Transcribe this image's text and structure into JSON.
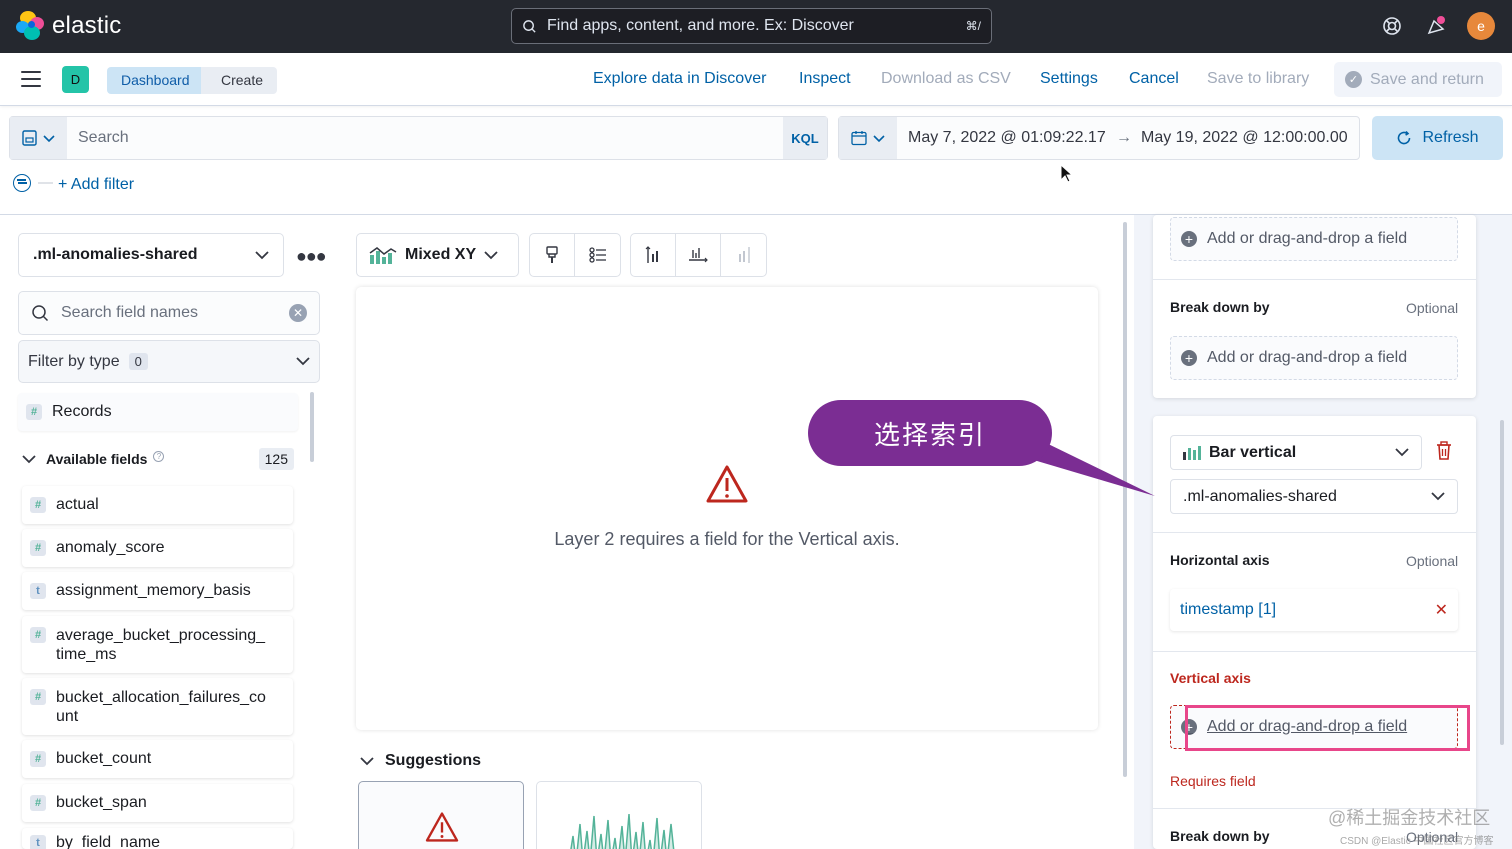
{
  "header": {
    "brand": "elastic",
    "search_placeholder": "Find apps, content, and more. Ex: Discover",
    "search_shortcut": "⌘/",
    "avatar_initial": "e"
  },
  "nav": {
    "space_initial": "D",
    "breadcrumbs": [
      "Dashboard",
      "Create"
    ],
    "links": {
      "explore": "Explore data in Discover",
      "inspect": "Inspect",
      "download_csv": "Download as CSV",
      "settings": "Settings",
      "cancel": "Cancel",
      "save_library": "Save to library",
      "save_return": "Save and return"
    }
  },
  "query": {
    "placeholder": "Search",
    "language": "KQL",
    "date_start": "May 7, 2022 @ 01:09:22.17",
    "date_arrow": "→",
    "date_end": "May 19, 2022 @ 12:00:00.00",
    "refresh": "Refresh",
    "add_filter": "+ Add filter"
  },
  "left_panel": {
    "index_pattern": ".ml-anomalies-shared",
    "field_search_placeholder": "Search field names",
    "filter_by_type": "Filter by type",
    "filter_count": "0",
    "records": "Records",
    "available_fields_label": "Available fields",
    "available_fields_count": "125",
    "fields": [
      {
        "type": "#",
        "name": "actual"
      },
      {
        "type": "#",
        "name": "anomaly_score"
      },
      {
        "type": "t",
        "name": "assignment_memory_basis"
      },
      {
        "type": "#",
        "name": "average_bucket_processing_time_ms"
      },
      {
        "type": "#",
        "name": "bucket_allocation_failures_count"
      },
      {
        "type": "#",
        "name": "bucket_count"
      },
      {
        "type": "#",
        "name": "bucket_span"
      },
      {
        "type": "t",
        "name": "by_field_name"
      }
    ]
  },
  "workspace": {
    "chart_type": "Mixed XY",
    "message": "Layer 2 requires a field for the Vertical axis.",
    "suggestions_label": "Suggestions"
  },
  "config_panel": {
    "drop_hint": "Add or drag-and-drop a field",
    "break_down_by": "Break down by",
    "optional": "Optional",
    "layer_chart_type": "Bar vertical",
    "layer_index": ".ml-anomalies-shared",
    "horizontal_axis": "Horizontal axis",
    "horizontal_field": "timestamp [1]",
    "vertical_axis": "Vertical axis",
    "requires_field": "Requires field"
  },
  "annotation": {
    "callout_text": "选择索引",
    "watermark": "@稀土掘金技术社区",
    "watermark_small": "CSDN @Elastic 中国社区官方博客"
  }
}
